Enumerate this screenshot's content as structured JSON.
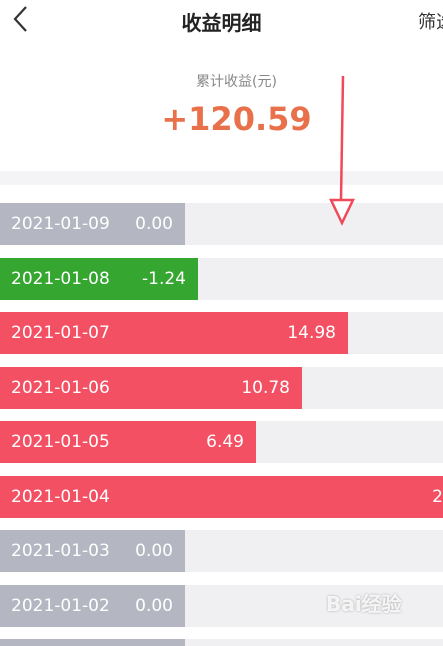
{
  "header": {
    "title": "收益明细",
    "back_icon": "chevron-left-icon",
    "filter_label": "筛选"
  },
  "summary": {
    "label": "累计收益(元)",
    "value": "+120.59"
  },
  "colors": {
    "positive": "#f45064",
    "negative": "#35a630",
    "zero": "#b4b6c1",
    "track": "#f0f0f3",
    "accent": "#e8704a"
  },
  "rows": [
    {
      "date": "2021-01-09",
      "value": "0.00"
    },
    {
      "date": "2021-01-08",
      "value": "-1.24"
    },
    {
      "date": "2021-01-07",
      "value": "14.98"
    },
    {
      "date": "2021-01-06",
      "value": "10.78"
    },
    {
      "date": "2021-01-05",
      "value": "6.49"
    },
    {
      "date": "2021-01-04",
      "value": "2"
    },
    {
      "date": "2021-01-03",
      "value": "0.00"
    },
    {
      "date": "2021-01-02",
      "value": "0.00"
    }
  ],
  "watermark": "Bai经验"
}
